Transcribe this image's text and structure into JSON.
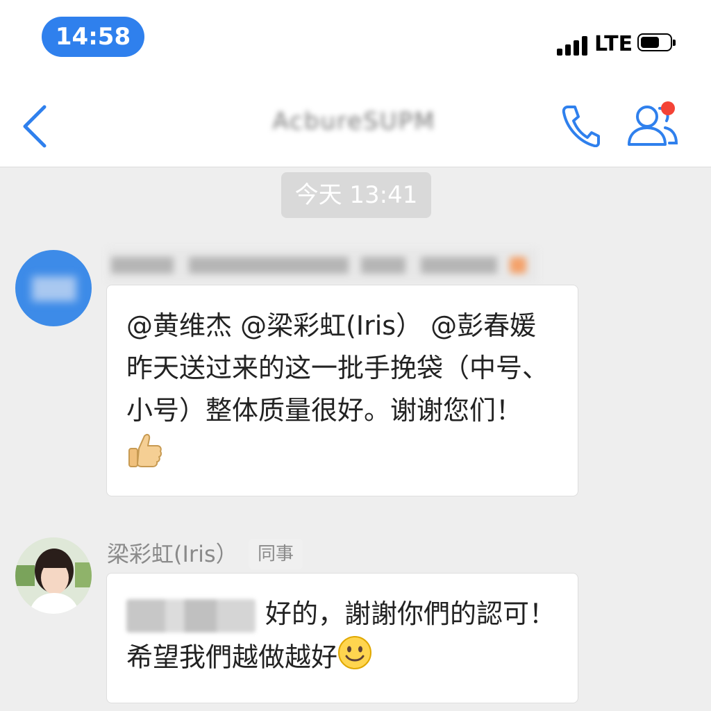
{
  "status_bar": {
    "time": "14:58",
    "network": "LTE"
  },
  "nav": {
    "title": "AcbureSUPM"
  },
  "timestamp": "今天 13:41",
  "messages": [
    {
      "text": "@黄维杰 @梁彩虹(Iris） @彭春媛 昨天送过来的这一批手挽袋（中号、小号）整体质量很好。谢谢您们！",
      "emoji": "thumbs-up"
    },
    {
      "sender": "梁彩虹(Iris）",
      "tag": "同事",
      "text": "好的，謝謝你們的認可！希望我們越做越好",
      "emoji": "smiley"
    }
  ],
  "colors": {
    "accent": "#2f80ed",
    "background": "#eeeeee",
    "badge": "#f44336"
  }
}
